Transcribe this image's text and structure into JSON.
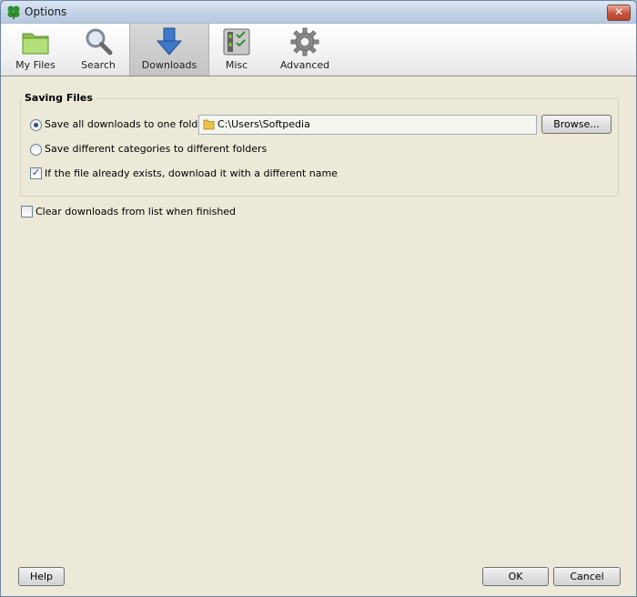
{
  "window": {
    "title": "Options"
  },
  "toolbar": {
    "items": [
      {
        "label": "My Files"
      },
      {
        "label": "Search"
      },
      {
        "label": "Downloads"
      },
      {
        "label": "Misc"
      },
      {
        "label": "Advanced"
      }
    ],
    "active": "Downloads"
  },
  "saving_files": {
    "heading": "Saving Files",
    "option_one_folder": "Save all downloads to one folder:",
    "folder_path": "C:\\Users\\Softpedia",
    "browse_label": "Browse...",
    "option_categories": "Save different categories to different folders",
    "option_rename": "If the file already exists, download it with a different name",
    "one_folder_selected": true,
    "rename_checked": true
  },
  "clear_downloads": {
    "label": "Clear downloads from list when finished",
    "checked": false
  },
  "footer": {
    "help": "Help",
    "ok": "OK",
    "cancel": "Cancel"
  },
  "colors": {
    "accent": "#2f4f7e",
    "dialog_bg": "#ece9d8"
  },
  "icons": [
    "clover-icon",
    "folder-icon",
    "magnifier-icon",
    "download-arrow-icon",
    "checklist-icon",
    "gear-icon",
    "close-icon"
  ]
}
